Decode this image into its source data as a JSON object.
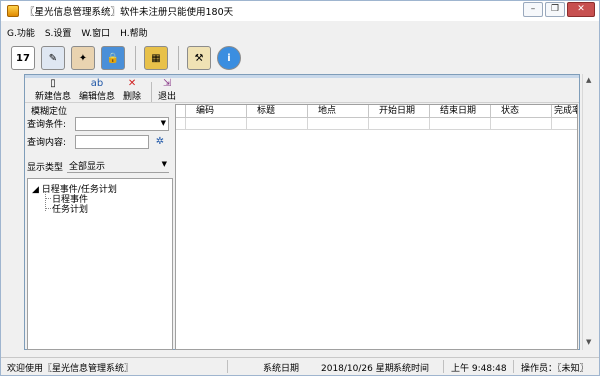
{
  "window": {
    "title": "〖星光信息管理系统〗软件未注册只能使用180天"
  },
  "menu": [
    {
      "label": "G.功能"
    },
    {
      "label": "S.设置"
    },
    {
      "label": "W.窗口"
    },
    {
      "label": "H.帮助"
    }
  ],
  "big_toolbar": [
    {
      "icon": "calendar-icon",
      "text": "17"
    },
    {
      "icon": "edit-pen-icon",
      "text": "✎"
    },
    {
      "icon": "contacts-icon",
      "text": "✦"
    },
    {
      "icon": "lock-folder-icon",
      "text": "🔒"
    },
    {
      "icon": "backup-icon",
      "text": "▦"
    },
    {
      "icon": "tools-icon",
      "text": "⚒"
    },
    {
      "icon": "info-icon",
      "text": "i"
    }
  ],
  "child_toolbar": {
    "new_label": "新建信息",
    "edit_label": "编辑信息",
    "delete_label": "删除",
    "exit_label": "退出"
  },
  "query": {
    "fuzzy_label": "模糊定位",
    "condition_label": "查询条件:",
    "condition_value": "",
    "content_label": "查询内容:",
    "content_value": "",
    "type_label": "显示类型",
    "type_value": "全部显示"
  },
  "tree": {
    "root": "日程事件/任务计划",
    "children": [
      "日程事件",
      "任务计划"
    ]
  },
  "grid": {
    "columns": [
      "编码",
      "标题",
      "地点",
      "开始日期",
      "结束日期",
      "状态",
      "完成率"
    ]
  },
  "status": {
    "welcome": "欢迎使用〖星光信息管理系统〗",
    "date_label": "系统日期",
    "date_value": "2018/10/26 星期",
    "time_label": "系统时间",
    "time_value": "上午 9:48:48",
    "operator": "操作员：〖未知〗"
  },
  "colors": {
    "accent": "#2058a8",
    "close": "#c75050"
  }
}
